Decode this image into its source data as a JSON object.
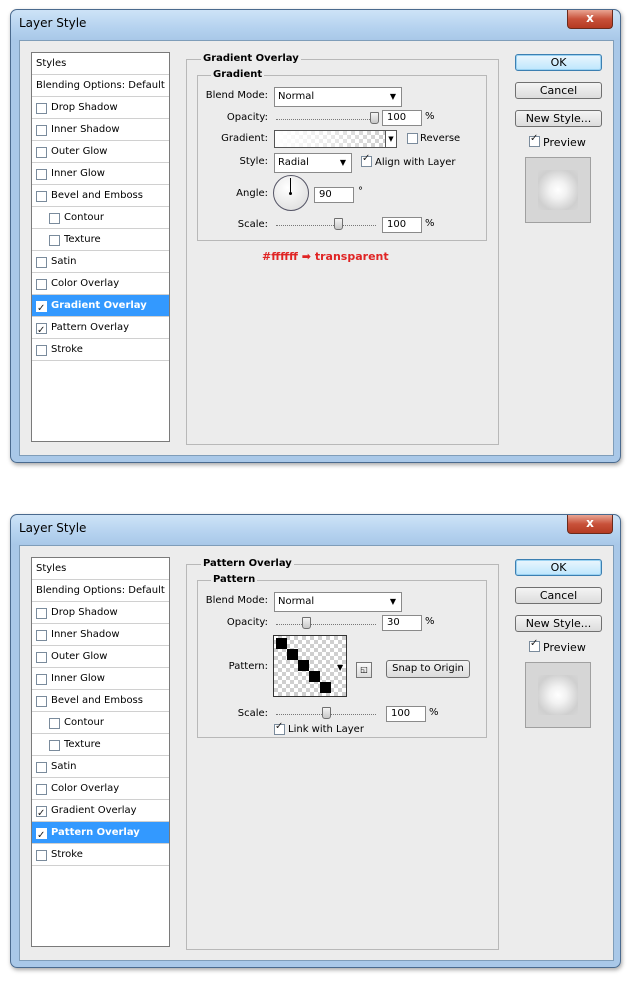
{
  "dialogs": [
    {
      "title": "Layer Style",
      "close": "x",
      "styles_header": "Styles",
      "blending": "Blending Options: Default",
      "items": [
        {
          "label": "Drop Shadow",
          "checked": false,
          "indent": false,
          "selected": false
        },
        {
          "label": "Inner Shadow",
          "checked": false,
          "indent": false,
          "selected": false
        },
        {
          "label": "Outer Glow",
          "checked": false,
          "indent": false,
          "selected": false
        },
        {
          "label": "Inner Glow",
          "checked": false,
          "indent": false,
          "selected": false
        },
        {
          "label": "Bevel and Emboss",
          "checked": false,
          "indent": false,
          "selected": false
        },
        {
          "label": "Contour",
          "checked": false,
          "indent": true,
          "selected": false
        },
        {
          "label": "Texture",
          "checked": false,
          "indent": true,
          "selected": false
        },
        {
          "label": "Satin",
          "checked": false,
          "indent": false,
          "selected": false
        },
        {
          "label": "Color Overlay",
          "checked": false,
          "indent": false,
          "selected": false
        },
        {
          "label": "Gradient Overlay",
          "checked": true,
          "indent": false,
          "selected": true
        },
        {
          "label": "Pattern Overlay",
          "checked": true,
          "indent": false,
          "selected": false
        },
        {
          "label": "Stroke",
          "checked": false,
          "indent": false,
          "selected": false
        }
      ],
      "panel_title": "Gradient Overlay",
      "group_title": "Gradient",
      "blend_mode_label": "Blend Mode:",
      "blend_mode": "Normal",
      "opacity_label": "Opacity:",
      "opacity": "100",
      "opacity_unit": "%",
      "gradient_label": "Gradient:",
      "reverse_label": "Reverse",
      "reverse": false,
      "style_label": "Style:",
      "style": "Radial",
      "align_label": "Align with Layer",
      "align": true,
      "angle_label": "Angle:",
      "angle": "90",
      "angle_unit": "°",
      "scale_label": "Scale:",
      "scale": "100",
      "scale_unit": "%",
      "annotation": {
        "from": "#ffffff",
        "arrow": "➡",
        "to": "transparent"
      },
      "buttons": {
        "ok": "OK",
        "cancel": "Cancel",
        "new_style": "New Style..."
      },
      "preview_label": "Preview",
      "preview_checked": true
    },
    {
      "title": "Layer Style",
      "close": "x",
      "styles_header": "Styles",
      "blending": "Blending Options: Default",
      "items": [
        {
          "label": "Drop Shadow",
          "checked": false,
          "indent": false,
          "selected": false
        },
        {
          "label": "Inner Shadow",
          "checked": false,
          "indent": false,
          "selected": false
        },
        {
          "label": "Outer Glow",
          "checked": false,
          "indent": false,
          "selected": false
        },
        {
          "label": "Inner Glow",
          "checked": false,
          "indent": false,
          "selected": false
        },
        {
          "label": "Bevel and Emboss",
          "checked": false,
          "indent": false,
          "selected": false
        },
        {
          "label": "Contour",
          "checked": false,
          "indent": true,
          "selected": false
        },
        {
          "label": "Texture",
          "checked": false,
          "indent": true,
          "selected": false
        },
        {
          "label": "Satin",
          "checked": false,
          "indent": false,
          "selected": false
        },
        {
          "label": "Color Overlay",
          "checked": false,
          "indent": false,
          "selected": false
        },
        {
          "label": "Gradient Overlay",
          "checked": true,
          "indent": false,
          "selected": false
        },
        {
          "label": "Pattern Overlay",
          "checked": true,
          "indent": false,
          "selected": true
        },
        {
          "label": "Stroke",
          "checked": false,
          "indent": false,
          "selected": false
        }
      ],
      "panel_title": "Pattern Overlay",
      "group_title": "Pattern",
      "blend_mode_label": "Blend Mode:",
      "blend_mode": "Normal",
      "opacity_label": "Opacity:",
      "opacity": "30",
      "opacity_unit": "%",
      "pattern_label": "Pattern:",
      "snap_label": "Snap to Origin",
      "scale_label": "Scale:",
      "scale": "100",
      "scale_unit": "%",
      "link_label": "Link with Layer",
      "link": true,
      "buttons": {
        "ok": "OK",
        "cancel": "Cancel",
        "new_style": "New Style..."
      },
      "preview_label": "Preview",
      "preview_checked": true
    }
  ]
}
